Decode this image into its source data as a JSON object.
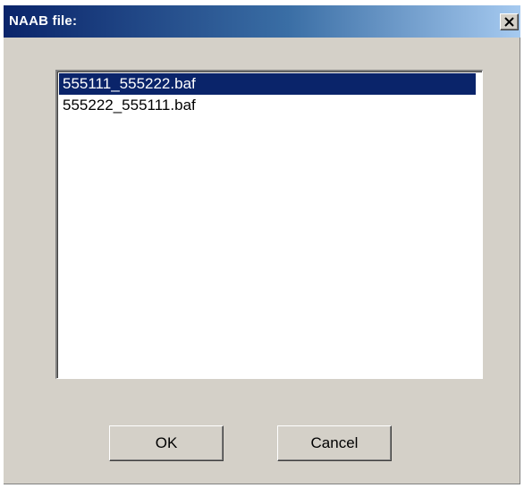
{
  "dialog": {
    "title": "NAAB file:",
    "close_icon": "close-icon"
  },
  "file_list": {
    "items": [
      {
        "label": "555111_555222.baf",
        "selected": true
      },
      {
        "label": "555222_555111.baf",
        "selected": false
      }
    ]
  },
  "buttons": {
    "ok_label": "OK",
    "cancel_label": "Cancel"
  },
  "colors": {
    "title_bar_start": "#0a246a",
    "title_bar_end": "#a6caf0",
    "selection": "#0a246a",
    "face": "#d4d0c8"
  }
}
